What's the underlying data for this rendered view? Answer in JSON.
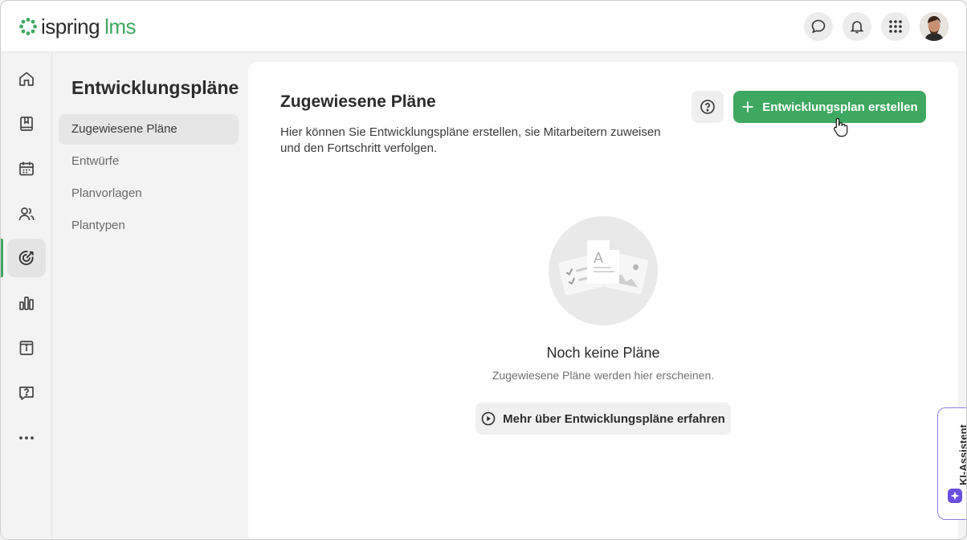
{
  "brand": {
    "name": "ispring",
    "product": "lms",
    "accent": "#3ea861"
  },
  "header": {
    "actions": [
      {
        "icon": "chat-bubble-icon"
      },
      {
        "icon": "bell-icon"
      },
      {
        "icon": "apps-grid-icon"
      }
    ]
  },
  "rail": {
    "items": [
      {
        "icon": "home-icon"
      },
      {
        "icon": "book-icon"
      },
      {
        "icon": "calendar-icon"
      },
      {
        "icon": "users-icon"
      },
      {
        "icon": "target-icon",
        "active": true
      },
      {
        "icon": "bar-chart-icon"
      },
      {
        "icon": "info-archive-icon"
      },
      {
        "icon": "help-chat-icon"
      },
      {
        "icon": "more-icon"
      }
    ]
  },
  "subnav": {
    "title": "Entwicklungspläne",
    "items": [
      {
        "label": "Zugewiesene Pläne",
        "active": true
      },
      {
        "label": "Entwürfe"
      },
      {
        "label": "Planvorlagen"
      },
      {
        "label": "Plantypen"
      }
    ]
  },
  "main": {
    "title": "Zugewiesene Pläne",
    "description": "Hier können Sie Entwicklungspläne erstellen, sie Mitarbeitern zuweisen und den Fortschritt verfolgen.",
    "help_icon": "question-circle-icon",
    "create_button": "Entwicklungsplan erstellen",
    "empty": {
      "title": "Noch keine Pläne",
      "subtitle": "Zugewiesene Pläne werden hier erscheinen.",
      "learn_button": "Mehr über Entwicklungspläne erfahren"
    }
  },
  "ai_assistant": {
    "label": "KI-Assistent",
    "color": "#6a4fe0"
  }
}
